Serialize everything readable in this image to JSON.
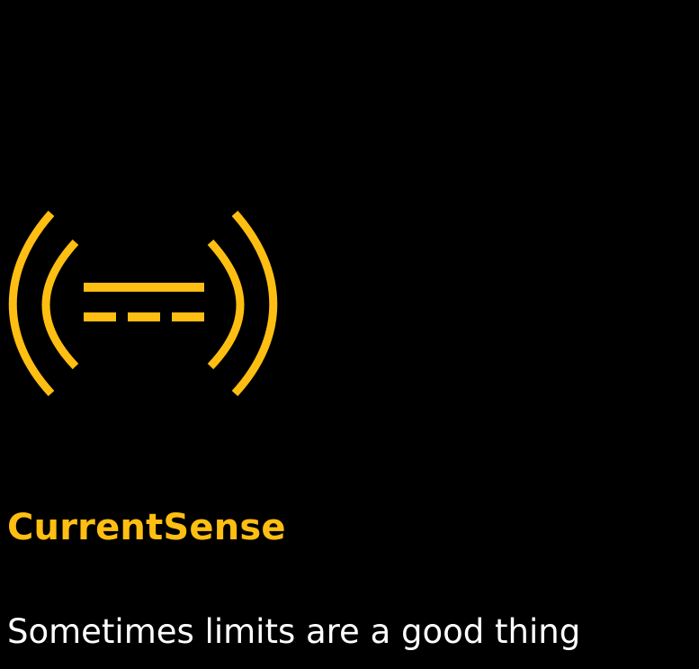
{
  "brand": {
    "name": "CurrentSense",
    "tagline": "Sometimes limits are a good thing",
    "logo_icon": "current-sense-icon",
    "colors": {
      "background": "#000000",
      "accent": "#FFBE12",
      "text": "#FFFFFF"
    }
  }
}
